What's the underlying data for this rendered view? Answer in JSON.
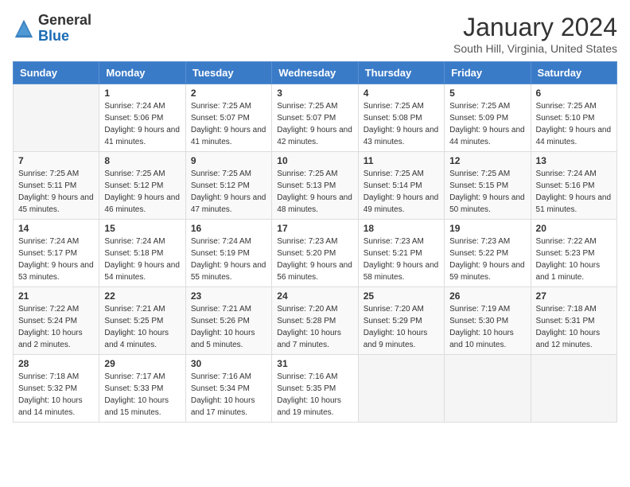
{
  "header": {
    "logo_general": "General",
    "logo_blue": "Blue",
    "month_title": "January 2024",
    "location": "South Hill, Virginia, United States"
  },
  "calendar": {
    "days_of_week": [
      "Sunday",
      "Monday",
      "Tuesday",
      "Wednesday",
      "Thursday",
      "Friday",
      "Saturday"
    ],
    "weeks": [
      [
        {
          "day": "",
          "sunrise": "",
          "sunset": "",
          "daylight": ""
        },
        {
          "day": "1",
          "sunrise": "Sunrise: 7:24 AM",
          "sunset": "Sunset: 5:06 PM",
          "daylight": "Daylight: 9 hours and 41 minutes."
        },
        {
          "day": "2",
          "sunrise": "Sunrise: 7:25 AM",
          "sunset": "Sunset: 5:07 PM",
          "daylight": "Daylight: 9 hours and 41 minutes."
        },
        {
          "day": "3",
          "sunrise": "Sunrise: 7:25 AM",
          "sunset": "Sunset: 5:07 PM",
          "daylight": "Daylight: 9 hours and 42 minutes."
        },
        {
          "day": "4",
          "sunrise": "Sunrise: 7:25 AM",
          "sunset": "Sunset: 5:08 PM",
          "daylight": "Daylight: 9 hours and 43 minutes."
        },
        {
          "day": "5",
          "sunrise": "Sunrise: 7:25 AM",
          "sunset": "Sunset: 5:09 PM",
          "daylight": "Daylight: 9 hours and 44 minutes."
        },
        {
          "day": "6",
          "sunrise": "Sunrise: 7:25 AM",
          "sunset": "Sunset: 5:10 PM",
          "daylight": "Daylight: 9 hours and 44 minutes."
        }
      ],
      [
        {
          "day": "7",
          "sunrise": "Sunrise: 7:25 AM",
          "sunset": "Sunset: 5:11 PM",
          "daylight": "Daylight: 9 hours and 45 minutes."
        },
        {
          "day": "8",
          "sunrise": "Sunrise: 7:25 AM",
          "sunset": "Sunset: 5:12 PM",
          "daylight": "Daylight: 9 hours and 46 minutes."
        },
        {
          "day": "9",
          "sunrise": "Sunrise: 7:25 AM",
          "sunset": "Sunset: 5:12 PM",
          "daylight": "Daylight: 9 hours and 47 minutes."
        },
        {
          "day": "10",
          "sunrise": "Sunrise: 7:25 AM",
          "sunset": "Sunset: 5:13 PM",
          "daylight": "Daylight: 9 hours and 48 minutes."
        },
        {
          "day": "11",
          "sunrise": "Sunrise: 7:25 AM",
          "sunset": "Sunset: 5:14 PM",
          "daylight": "Daylight: 9 hours and 49 minutes."
        },
        {
          "day": "12",
          "sunrise": "Sunrise: 7:25 AM",
          "sunset": "Sunset: 5:15 PM",
          "daylight": "Daylight: 9 hours and 50 minutes."
        },
        {
          "day": "13",
          "sunrise": "Sunrise: 7:24 AM",
          "sunset": "Sunset: 5:16 PM",
          "daylight": "Daylight: 9 hours and 51 minutes."
        }
      ],
      [
        {
          "day": "14",
          "sunrise": "Sunrise: 7:24 AM",
          "sunset": "Sunset: 5:17 PM",
          "daylight": "Daylight: 9 hours and 53 minutes."
        },
        {
          "day": "15",
          "sunrise": "Sunrise: 7:24 AM",
          "sunset": "Sunset: 5:18 PM",
          "daylight": "Daylight: 9 hours and 54 minutes."
        },
        {
          "day": "16",
          "sunrise": "Sunrise: 7:24 AM",
          "sunset": "Sunset: 5:19 PM",
          "daylight": "Daylight: 9 hours and 55 minutes."
        },
        {
          "day": "17",
          "sunrise": "Sunrise: 7:23 AM",
          "sunset": "Sunset: 5:20 PM",
          "daylight": "Daylight: 9 hours and 56 minutes."
        },
        {
          "day": "18",
          "sunrise": "Sunrise: 7:23 AM",
          "sunset": "Sunset: 5:21 PM",
          "daylight": "Daylight: 9 hours and 58 minutes."
        },
        {
          "day": "19",
          "sunrise": "Sunrise: 7:23 AM",
          "sunset": "Sunset: 5:22 PM",
          "daylight": "Daylight: 9 hours and 59 minutes."
        },
        {
          "day": "20",
          "sunrise": "Sunrise: 7:22 AM",
          "sunset": "Sunset: 5:23 PM",
          "daylight": "Daylight: 10 hours and 1 minute."
        }
      ],
      [
        {
          "day": "21",
          "sunrise": "Sunrise: 7:22 AM",
          "sunset": "Sunset: 5:24 PM",
          "daylight": "Daylight: 10 hours and 2 minutes."
        },
        {
          "day": "22",
          "sunrise": "Sunrise: 7:21 AM",
          "sunset": "Sunset: 5:25 PM",
          "daylight": "Daylight: 10 hours and 4 minutes."
        },
        {
          "day": "23",
          "sunrise": "Sunrise: 7:21 AM",
          "sunset": "Sunset: 5:26 PM",
          "daylight": "Daylight: 10 hours and 5 minutes."
        },
        {
          "day": "24",
          "sunrise": "Sunrise: 7:20 AM",
          "sunset": "Sunset: 5:28 PM",
          "daylight": "Daylight: 10 hours and 7 minutes."
        },
        {
          "day": "25",
          "sunrise": "Sunrise: 7:20 AM",
          "sunset": "Sunset: 5:29 PM",
          "daylight": "Daylight: 10 hours and 9 minutes."
        },
        {
          "day": "26",
          "sunrise": "Sunrise: 7:19 AM",
          "sunset": "Sunset: 5:30 PM",
          "daylight": "Daylight: 10 hours and 10 minutes."
        },
        {
          "day": "27",
          "sunrise": "Sunrise: 7:18 AM",
          "sunset": "Sunset: 5:31 PM",
          "daylight": "Daylight: 10 hours and 12 minutes."
        }
      ],
      [
        {
          "day": "28",
          "sunrise": "Sunrise: 7:18 AM",
          "sunset": "Sunset: 5:32 PM",
          "daylight": "Daylight: 10 hours and 14 minutes."
        },
        {
          "day": "29",
          "sunrise": "Sunrise: 7:17 AM",
          "sunset": "Sunset: 5:33 PM",
          "daylight": "Daylight: 10 hours and 15 minutes."
        },
        {
          "day": "30",
          "sunrise": "Sunrise: 7:16 AM",
          "sunset": "Sunset: 5:34 PM",
          "daylight": "Daylight: 10 hours and 17 minutes."
        },
        {
          "day": "31",
          "sunrise": "Sunrise: 7:16 AM",
          "sunset": "Sunset: 5:35 PM",
          "daylight": "Daylight: 10 hours and 19 minutes."
        },
        {
          "day": "",
          "sunrise": "",
          "sunset": "",
          "daylight": ""
        },
        {
          "day": "",
          "sunrise": "",
          "sunset": "",
          "daylight": ""
        },
        {
          "day": "",
          "sunrise": "",
          "sunset": "",
          "daylight": ""
        }
      ]
    ]
  }
}
